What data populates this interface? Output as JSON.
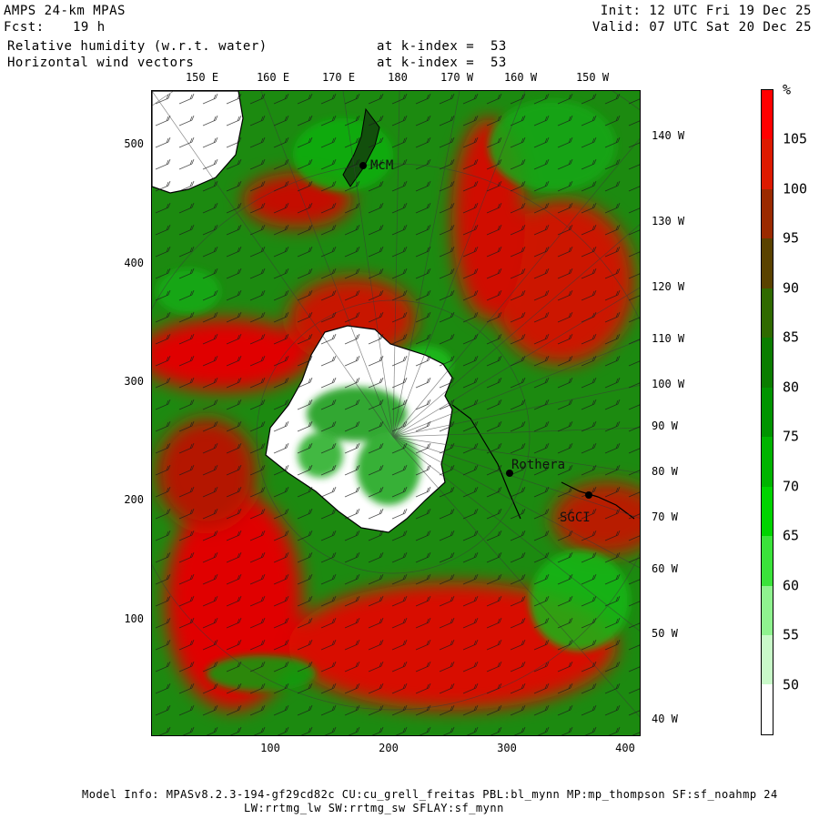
{
  "header": {
    "model": "AMPS 24-km MPAS",
    "fcst_label": "Fcst:",
    "fcst_value": "19 h",
    "init": "Init: 12 UTC Fri 19 Dec 25",
    "valid": "Valid: 07 UTC Sat 20 Dec 25",
    "field1": "Relative humidity (w.r.t. water)",
    "field1_level": "at k-index =  53",
    "field2": "Horizontal wind vectors",
    "field2_level": "at k-index =  53"
  },
  "axes": {
    "lon_top": [
      "150 E",
      "160 E",
      "170 E",
      "180",
      "170 W",
      "160 W",
      "150 W"
    ],
    "lon_right": [
      "140 W",
      "130 W",
      "120 W",
      "110 W",
      "100 W",
      "90 W",
      "80 W",
      "70 W",
      "60 W",
      "50 W",
      "40 W"
    ],
    "y_left": [
      "500",
      "400",
      "300",
      "200",
      "100"
    ],
    "x_bottom": [
      "100",
      "200",
      "300",
      "400"
    ]
  },
  "stations": [
    "McM",
    "Rothera",
    "SGCI"
  ],
  "colorbar": {
    "unit": "%",
    "labels": [
      "105",
      "100",
      "95",
      "90",
      "85",
      "80",
      "75",
      "70",
      "65",
      "60",
      "55",
      "50"
    ],
    "colors": [
      "#ff0000",
      "#dd1a00",
      "#9b2a00",
      "#5a4200",
      "#2f6a00",
      "#0a7d00",
      "#009400",
      "#00b400",
      "#00d400",
      "#3ae33a",
      "#8ff28f",
      "#c9f9c9",
      "#ffffff"
    ]
  },
  "footer": {
    "line1": "Model Info: MPASv8.2.3-194-gf29cd82c CU:cu_grell_freitas PBL:bl_mynn MP:mp_thompson SF:sf_noahmp 24",
    "line2": "LW:rrtmg_lw SW:rrtmg_sw SFLAY:sf_mynn"
  }
}
